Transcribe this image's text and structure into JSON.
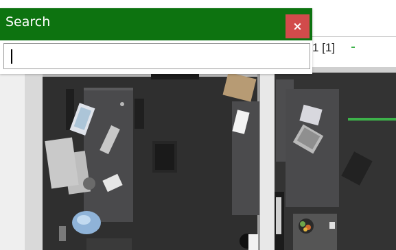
{
  "search_dialog": {
    "title": "Search",
    "close_label": "×",
    "input_value": ""
  },
  "toolbar": {
    "page_indicator": "1 [1]"
  },
  "colors": {
    "header_green": "#0d7310",
    "close_red": "#d24b4b",
    "accent_green": "#3db24a"
  }
}
